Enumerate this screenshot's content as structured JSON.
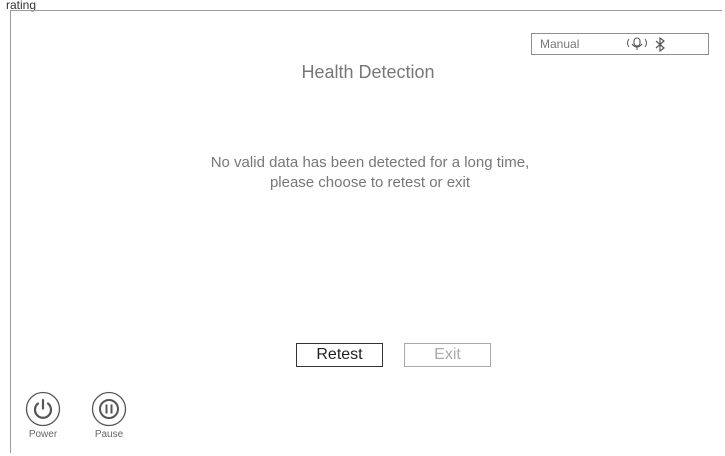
{
  "window": {
    "title": "Health Detection"
  },
  "header_label": "rating",
  "status_bar": {
    "mode": "Manual",
    "icons": [
      "microphone-icon",
      "bluetooth-icon"
    ]
  },
  "message": {
    "line1": "No valid data has been detected for a long time,",
    "line2": "please choose to retest or exit"
  },
  "buttons": {
    "retest": "Retest",
    "exit": "Exit"
  },
  "controls": {
    "power": "Power",
    "pause": "Pause"
  }
}
